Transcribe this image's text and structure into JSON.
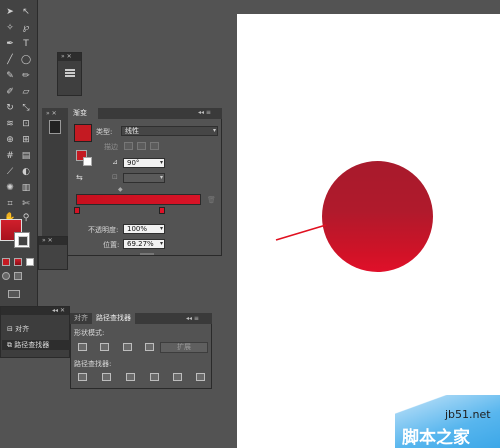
{
  "gradient_panel": {
    "tab_label": "渐变",
    "type_label": "类型:",
    "type_value": "线性",
    "stroke_label": "描边",
    "angle_value": "90°",
    "opacity_label": "不透明度:",
    "opacity_value": "100%",
    "location_label": "位置:",
    "location_value": "69.27%"
  },
  "pathfinder_panel": {
    "tab_align": "对齐",
    "tab_pathfinder": "路径查找器",
    "shape_modes_label": "形状模式:",
    "expand_button": "扩展",
    "pathfinders_label": "路径查找器:"
  },
  "dock": {
    "items": [
      "对齐",
      "路径查找器"
    ]
  },
  "watermark": {
    "url": "jb51.net",
    "text": "脚本之家"
  },
  "colors": {
    "ui_background": "#535353",
    "panel_dark": "#3d3d3d",
    "gradient_red": "#c8101e",
    "canvas": "#ffffff",
    "arrow": "#e01020"
  }
}
